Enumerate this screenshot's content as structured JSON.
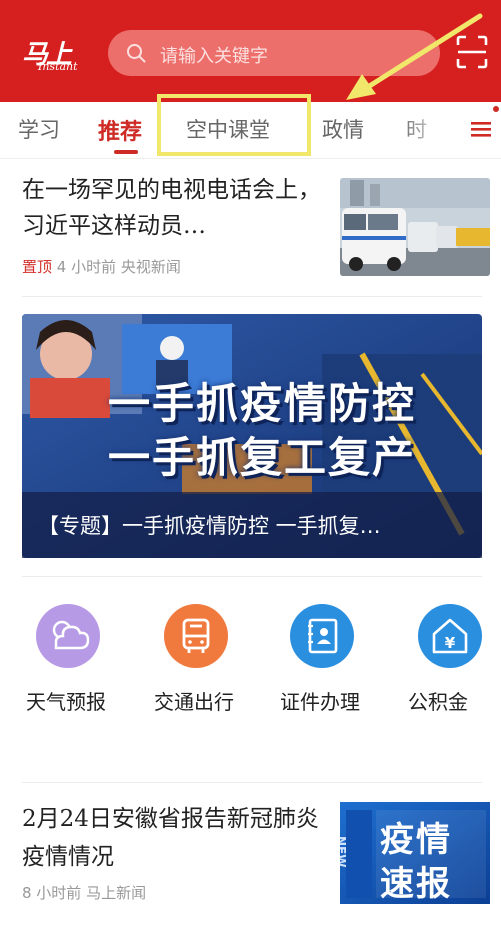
{
  "header": {
    "logo_text": "马上",
    "logo_sub": "Instant",
    "search_placeholder": "请输入关键字"
  },
  "tabs": [
    {
      "label": "学习"
    },
    {
      "label": "推荐"
    },
    {
      "label": "空中课堂"
    },
    {
      "label": "政情"
    },
    {
      "label": "时"
    }
  ],
  "articles": [
    {
      "title": "在一场罕见的电视电话会上，习近平这样动员…",
      "pin": "置顶",
      "time": "4 小时前",
      "source": "央视新闻"
    },
    {
      "title": "2月24日安徽省报告新冠肺炎疫情情况",
      "time": "8 小时前",
      "source": "马上新闻"
    }
  ],
  "banner": {
    "line1": "一手抓疫情防控",
    "line2": "一手抓复工复产",
    "caption": "【专题】一手抓疫情防控 一手抓复…"
  },
  "services": [
    {
      "label": "天气预报",
      "icon": "weather-icon",
      "color": "#b79ae6"
    },
    {
      "label": "交通出行",
      "icon": "bus-icon",
      "color": "#f07a3d"
    },
    {
      "label": "证件办理",
      "icon": "id-card-icon",
      "color": "#2b8fe0"
    },
    {
      "label": "公积金",
      "icon": "housing-fund-icon",
      "color": "#2b8fe0"
    }
  ],
  "thumb2": {
    "line1": "疫情",
    "line2": "速报",
    "tag": "NEW"
  },
  "colors": {
    "brand_red": "#d6201f",
    "active_tab": "#cf2b25",
    "highlight": "#f1e76b"
  }
}
